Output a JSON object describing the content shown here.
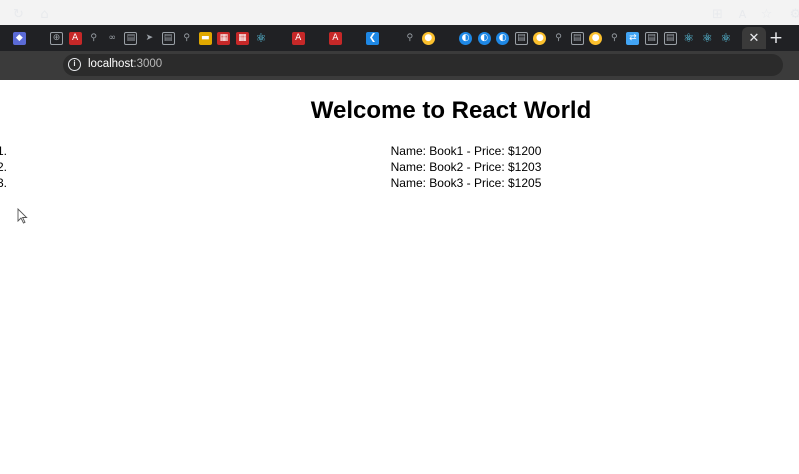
{
  "browser": {
    "tabs": [
      {
        "icon": "layers-icon",
        "color": "#5b6bd6",
        "glyph": "◆"
      },
      {
        "icon": "blank-icon",
        "color": "",
        "glyph": ""
      },
      {
        "icon": "globe-icon",
        "color": "outline",
        "glyph": "⊕"
      },
      {
        "icon": "pdf-icon",
        "color": "#c62828",
        "glyph": "A"
      },
      {
        "icon": "search-icon",
        "color": "blank",
        "glyph": "⚲"
      },
      {
        "icon": "link-icon",
        "color": "blank",
        "glyph": "∞"
      },
      {
        "icon": "page-icon",
        "color": "outline",
        "glyph": "▤"
      },
      {
        "icon": "send-icon",
        "color": "blank",
        "glyph": "➤"
      },
      {
        "icon": "page-icon",
        "color": "outline",
        "glyph": "▤"
      },
      {
        "icon": "search-icon",
        "color": "blank",
        "glyph": "⚲"
      },
      {
        "icon": "folder-icon",
        "color": "#e0a800",
        "glyph": "▬"
      },
      {
        "icon": "app-icon",
        "color": "#c62828",
        "glyph": "▦"
      },
      {
        "icon": "app-icon",
        "color": "#c62828",
        "glyph": "▦"
      },
      {
        "icon": "react-icon",
        "color": "blank",
        "glyph": "⚛"
      },
      {
        "icon": "blank-icon",
        "color": "",
        "glyph": ""
      },
      {
        "icon": "pdf-icon",
        "color": "#c62828",
        "glyph": "A"
      },
      {
        "icon": "blank-icon",
        "color": "",
        "glyph": ""
      },
      {
        "icon": "pdf-icon",
        "color": "#c62828",
        "glyph": "A"
      },
      {
        "icon": "blank-icon",
        "color": "",
        "glyph": ""
      },
      {
        "icon": "vscode-icon",
        "color": "#1e88e5",
        "glyph": "❮"
      },
      {
        "icon": "blank-icon",
        "color": "",
        "glyph": ""
      },
      {
        "icon": "search-icon",
        "color": "blank",
        "glyph": "⚲"
      },
      {
        "icon": "chrome-icon",
        "color": "#fbc02d",
        "glyph": "●"
      },
      {
        "icon": "blank-icon",
        "color": "",
        "glyph": ""
      },
      {
        "icon": "edge-icon",
        "color": "#1e88e5",
        "glyph": "◐"
      },
      {
        "icon": "edge-icon",
        "color": "#1e88e5",
        "glyph": "◐"
      },
      {
        "icon": "edge-icon",
        "color": "#1e88e5",
        "glyph": "◐"
      },
      {
        "icon": "page-icon",
        "color": "outline",
        "glyph": "▤"
      },
      {
        "icon": "chrome-icon",
        "color": "#fbc02d",
        "glyph": "●"
      },
      {
        "icon": "search-icon",
        "color": "blank",
        "glyph": "⚲"
      },
      {
        "icon": "page-icon",
        "color": "outline",
        "glyph": "▤"
      },
      {
        "icon": "chrome-icon",
        "color": "#fbc02d",
        "glyph": "●"
      },
      {
        "icon": "search-icon",
        "color": "blank",
        "glyph": "⚲"
      },
      {
        "icon": "translate-icon",
        "color": "#42a5f5",
        "glyph": "⇄"
      },
      {
        "icon": "page-icon",
        "color": "outline",
        "glyph": "▤"
      },
      {
        "icon": "page-icon",
        "color": "outline",
        "glyph": "▤"
      },
      {
        "icon": "react-icon",
        "color": "blank",
        "glyph": "⚛"
      },
      {
        "icon": "react-icon",
        "color": "blank",
        "glyph": "⚛"
      },
      {
        "icon": "react-icon",
        "color": "blank",
        "glyph": "⚛"
      }
    ],
    "active_tab_close": "✕",
    "new_tab": "+",
    "url_host": "localhost",
    "url_port": ":3000"
  },
  "page": {
    "title": "Welcome to React World",
    "books": [
      {
        "number": "1.",
        "text": "Name: Book1 - Price: $1200"
      },
      {
        "number": "2.",
        "text": "Name: Book2 - Price: $1203"
      },
      {
        "number": "3.",
        "text": "Name: Book3 - Price: $1205"
      }
    ]
  }
}
